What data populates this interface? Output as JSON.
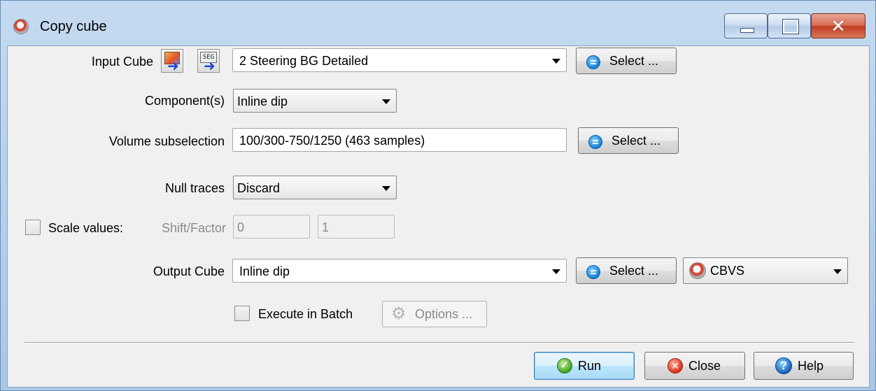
{
  "window": {
    "title": "Copy cube",
    "controls": {
      "minimize": "minimize",
      "maximize": "maximize",
      "close": "✕"
    }
  },
  "input_cube": {
    "label": "Input Cube",
    "value": "2 Steering BG Detailed",
    "select_label": "Select ..."
  },
  "components": {
    "label": "Component(s)",
    "value": "Inline dip"
  },
  "volume_subselection": {
    "label": "Volume subselection",
    "value": "100/300-750/1250 (463 samples)",
    "select_label": "Select ..."
  },
  "null_traces": {
    "label": "Null traces",
    "value": "Discard"
  },
  "scale_values": {
    "label": "Scale values:",
    "checked": false,
    "shift_factor_label": "Shift/Factor",
    "shift": "0",
    "factor": "1"
  },
  "output_cube": {
    "label": "Output Cube",
    "value": "Inline dip",
    "select_label": "Select ...",
    "format": "CBVS"
  },
  "batch": {
    "label": "Execute in Batch",
    "checked": false,
    "options_label": "Options ..."
  },
  "buttons": {
    "run": "Run",
    "close": "Close",
    "help": "Help"
  },
  "icons": {
    "app": "opendtect-icon",
    "input_cube_1": "image-import-icon",
    "input_cube_2": "segy-import-icon",
    "select": "select-list-icon",
    "run": "checkmark-icon",
    "close": "cancel-icon",
    "help": "help-icon",
    "options": "gear-icon"
  }
}
